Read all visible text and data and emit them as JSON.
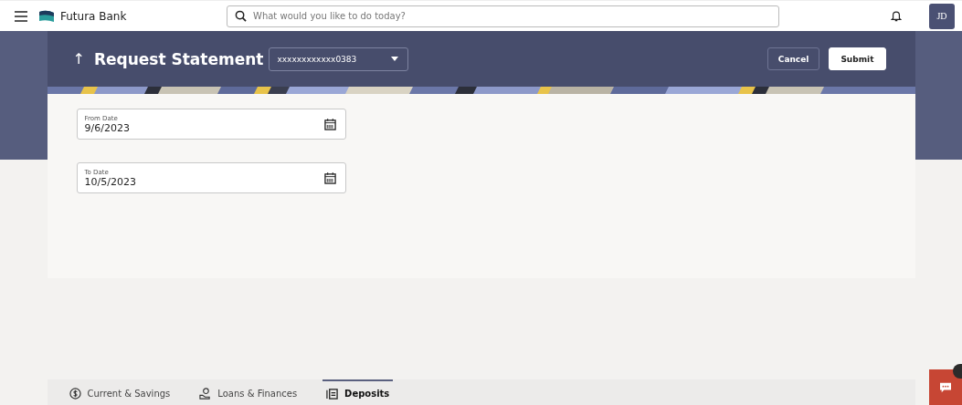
{
  "header": {
    "brand": "Futura Bank",
    "search": {
      "placeholder": "What would you like to do today?"
    },
    "avatar": "JD"
  },
  "page": {
    "back_icon": "↑",
    "title": "Request Statement",
    "account": {
      "value": "xxxxxxxxxxxx0383"
    },
    "buttons": [
      {
        "label": "Cancel",
        "kind": "secondary"
      },
      {
        "label": "Submit",
        "kind": "primary"
      }
    ]
  },
  "fields": [
    {
      "label": "From Date",
      "value": "9/6/2023"
    },
    {
      "label": "To Date",
      "value": "10/5/2023"
    }
  ],
  "bottom_tabs": [
    {
      "label": "Current & Savings",
      "kind": "savings",
      "selected": false
    },
    {
      "label": "Loans & Finances",
      "kind": "loans",
      "selected": false
    },
    {
      "label": "Deposits",
      "kind": "deposits",
      "selected": true
    }
  ]
}
